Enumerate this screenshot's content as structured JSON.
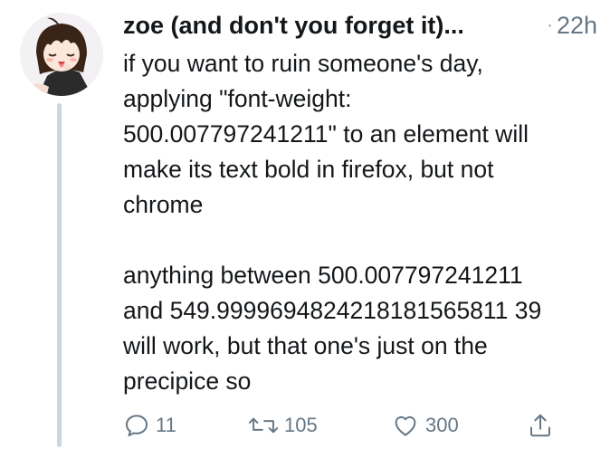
{
  "author": {
    "display_name": "zoe (and don't you forget it)...",
    "avatar_icon": "anime-girl-avatar-icon"
  },
  "timestamp": "22h",
  "separator": "·",
  "text_lines": [
    "if you want to ruin someone's day,",
    "applying \"font-weight:",
    "500.007797241211\" to an element will",
    "make its text bold in firefox, but not",
    "chrome",
    "",
    "anything between 500.007797241211",
    "and 549.9999694824218181565811 39",
    "will work, but that one's just on the",
    "precipice so"
  ],
  "actions": {
    "reply": {
      "icon": "reply-icon",
      "count": "11"
    },
    "retweet": {
      "icon": "retweet-icon",
      "count": "105"
    },
    "like": {
      "icon": "heart-icon",
      "count": "300"
    },
    "share": {
      "icon": "share-icon"
    }
  },
  "colors": {
    "text": "#14171a",
    "secondary": "#657786",
    "thread_line": "#ccd6dd"
  }
}
